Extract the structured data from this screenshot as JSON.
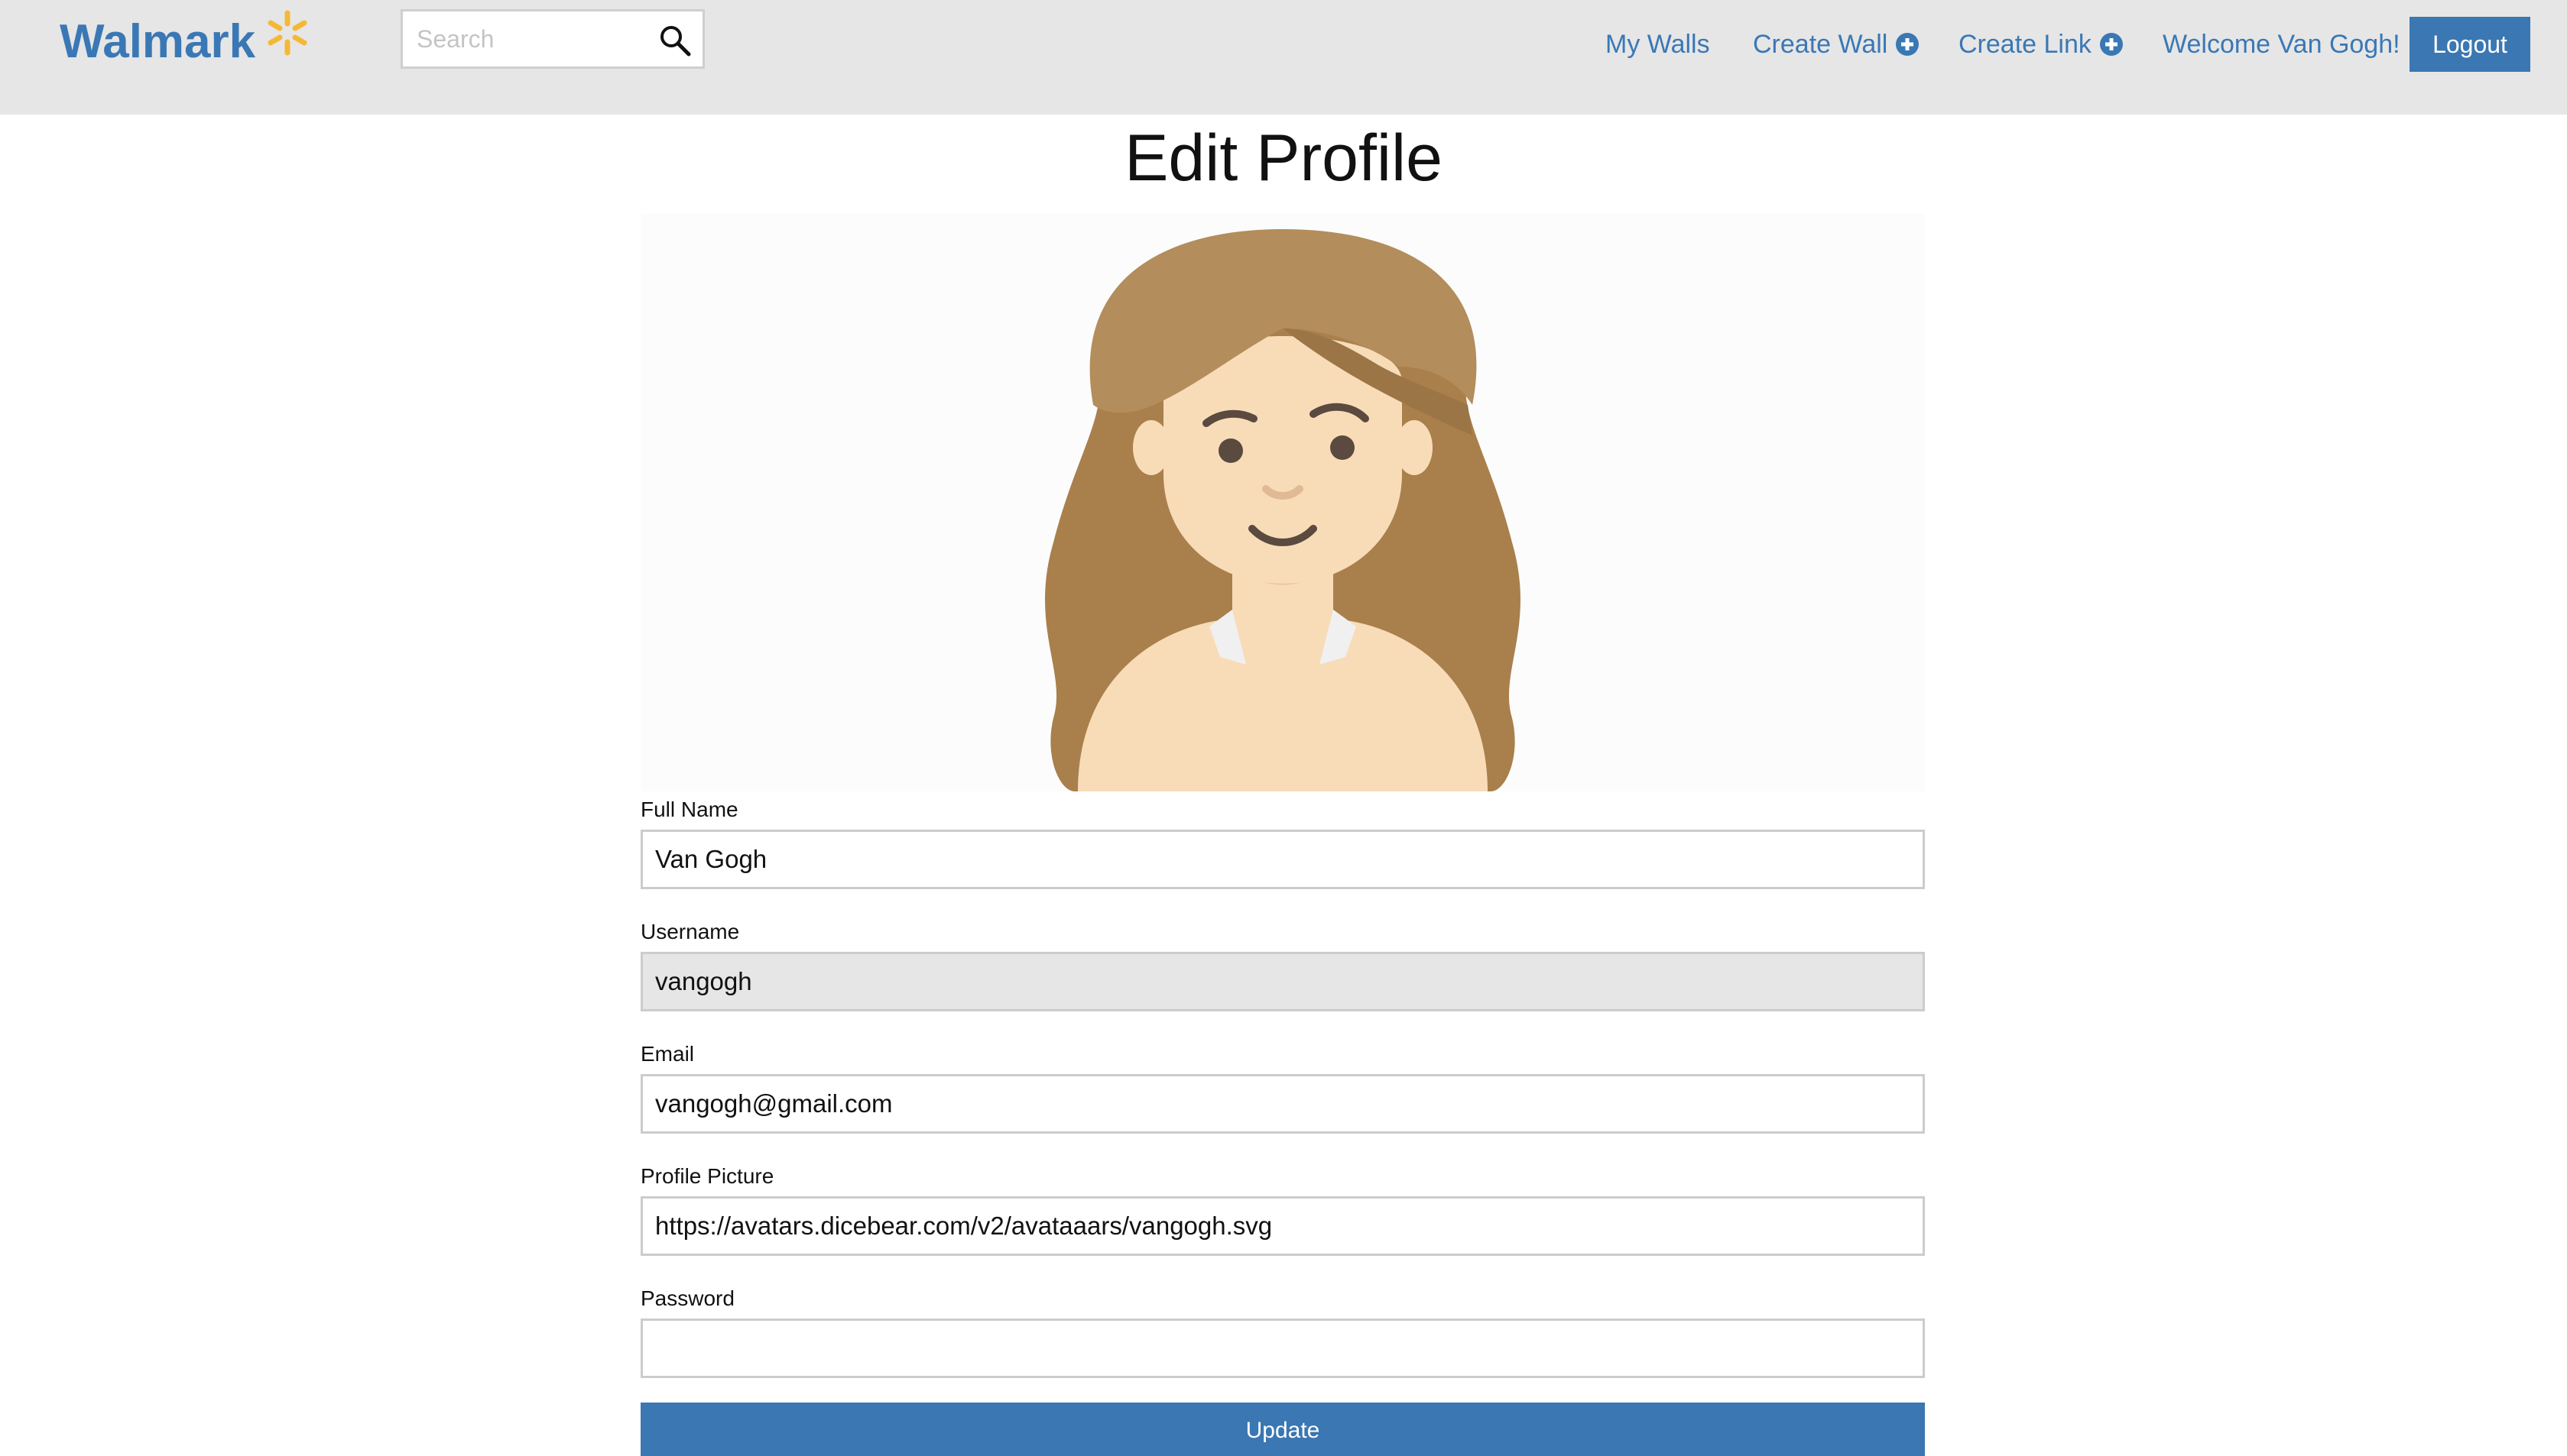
{
  "header": {
    "brand": "Walmark",
    "search_placeholder": "Search",
    "nav": {
      "my_walls": "My Walls",
      "create_wall": "Create Wall",
      "create_link": "Create Link",
      "welcome": "Welcome Van Gogh!",
      "logout": "Logout"
    }
  },
  "page": {
    "title": "Edit Profile"
  },
  "form": {
    "full_name": {
      "label": "Full Name",
      "value": "Van Gogh"
    },
    "username": {
      "label": "Username",
      "value": "vangogh"
    },
    "email": {
      "label": "Email",
      "value": "vangogh@gmail.com"
    },
    "profile_picture": {
      "label": "Profile Picture",
      "value": "https://avatars.dicebear.com/v2/avataaars/vangogh.svg"
    },
    "password": {
      "label": "Password",
      "value": ""
    },
    "submit_label": "Update"
  },
  "colors": {
    "brand_blue": "#3a78b5",
    "brand_spark": "#f5b836",
    "button_blue": "#3a77b3",
    "header_bg": "#e6e6e6"
  },
  "icons": {
    "search": "search-icon",
    "plus": "plus-circle-icon",
    "brand": "spark-icon"
  }
}
